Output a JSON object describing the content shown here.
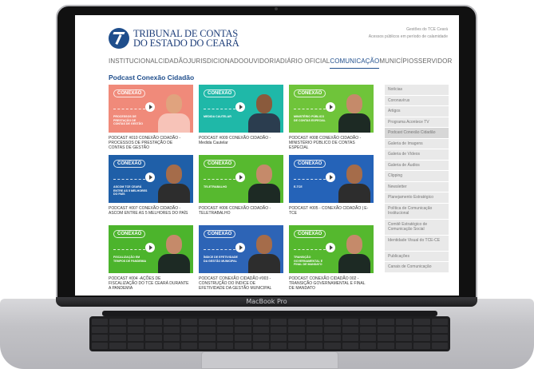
{
  "device": {
    "hinge_label": "MacBook Pro"
  },
  "site": {
    "logo_line1": "TRIBUNAL DE CONTAS",
    "logo_line2": "DO ESTADO DO CEARÁ",
    "util_link1": "Gestões do TCE Ceará",
    "util_link2": "Acessos públicos em período de calamidade"
  },
  "nav": [
    "INSTITUCIONAL",
    "CIDADÃO",
    "JURISDICIONADO",
    "OUVIDORIA",
    "DIÁRIO OFICIAL",
    "COMUNICAÇÃO",
    "MUNICÍPIOS",
    "SERVIDOR"
  ],
  "page_title": "Podcast Conexão Cidadão",
  "cards": [
    {
      "brand": "CONEXÃO",
      "caption": "PROCESSOS DE PRESTAÇÃO DE CONTAS DE GESTÃO",
      "title": "PODCAST #010 CONEXÃO CIDADÃO - PROCESSOS DE PRESTAÇÃO DE CONTAS DE GESTÃO",
      "bg": "#f08a7a",
      "skin": "#e0a37e",
      "shirt": "#f7c3b8"
    },
    {
      "brand": "CONEXÃO",
      "caption": "MEDIDA CAUTELAR",
      "title": "PODCAST #009 CONEXÃO CIDADÃO - Medida Cautelar",
      "bg": "#1fb8a8",
      "skin": "#8a5a3c",
      "shirt": "#2b3d4f"
    },
    {
      "brand": "CONEXÃO",
      "caption": "MINISTÉRIO PÚBLICO DE CONTAS ESPECIAL",
      "title": "PODCAST #008 CONEXÃO CIDADÃO - MINISTÉRIO PÚBLICO DE CONTAS ESPECIAL",
      "bg": "#6fc43a",
      "skin": "#c58a6a",
      "shirt": "#1d2a24"
    },
    {
      "brand": "CONEXÃO",
      "caption": "ASCOM TCE CEARÁ ENTRE AS 5 MELHORES DO PAÍS",
      "title": "PODCAST #007 CONEXÃO CIDADÃO - ASCOM ENTRE AS 5 MELHORES DO PAÍS",
      "bg": "#1f5fa8",
      "skin": "#a56c4a",
      "shirt": "#2d2d2d"
    },
    {
      "brand": "CONEXÃO",
      "caption": "TELETRABALHO",
      "title": "PODCAST #006 CONEXÃO CIDADÃO - TELETRABALHO",
      "bg": "#57b92f",
      "skin": "#c58a6a",
      "shirt": "#1d2a24"
    },
    {
      "brand": "CONEXÃO",
      "caption": "E-TCE",
      "title": "PODCAST #005 - CONEXÃO CIDADÃO | E-TCE",
      "bg": "#2563b8",
      "skin": "#a56c4a",
      "shirt": "#2d2d2d"
    },
    {
      "brand": "CONEXÃO",
      "caption": "FISCALIZAÇÃO EM TEMPOS DE PANDEMIA",
      "title": "PODCAST #004 -AÇÕES DE FISCALIZAÇÃO DO TCE CEARÁ DURANTE A PANDEMIA",
      "bg": "#4cb42c",
      "skin": "#c58a6a",
      "shirt": "#1d2a24"
    },
    {
      "brand": "CONEXÃO",
      "caption": "ÍNDICE DE EFETIVIDADE DA GESTÃO MUNICIPAL",
      "title": "PODCAST CONEXÃO CIDADÃO #003 - CONSTRUÇÃO DO ÍNDICE DE EFETIVIDADE DA GESTÃO MUNICIPAL",
      "bg": "#2d64b6",
      "skin": "#a56c4a",
      "shirt": "#2d2d2d"
    },
    {
      "brand": "CONEXÃO",
      "caption": "TRANSIÇÃO GOVERNAMENTAL E FINAL DE MANDATO",
      "title": "PODCAST CONEXÃO CIDADÃO 002 - TRANSIÇÃO GOVERNAMENTAL E FINAL DE MANDATO",
      "bg": "#55b82e",
      "skin": "#c58a6a",
      "shirt": "#1d2a24"
    }
  ],
  "sidebar": [
    "Notícias",
    "Coronavírus",
    "Artigos",
    "Programa Acontece TV",
    "Podcast Conexão Cidadão",
    "Galeria de Imagens",
    "Galeria de Vídeos",
    "Galeria de Áudios",
    "Clipping",
    "Newsletter",
    "Planejamento Estratégico",
    "Política de Comunicação Institucional",
    "Comitê Estratégico de Comunicação Social",
    "Identidade Visual do TCE-CE",
    "Publicações",
    "Canais de Comunicação"
  ]
}
